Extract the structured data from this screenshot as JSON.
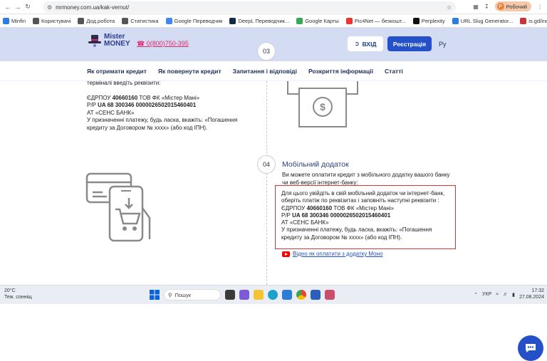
{
  "browser": {
    "url": "mrmoney.com.ua/kak-vernut/",
    "profile_label": "Робочий",
    "profile_initial": "Р"
  },
  "bookmarks": [
    {
      "label": "Minfin",
      "color": "#2a7de1"
    },
    {
      "label": "Користувачі",
      "color": "#555"
    },
    {
      "label": "Дод.робота",
      "color": "#555"
    },
    {
      "label": "Статистика",
      "color": "#555"
    },
    {
      "label": "Google Переводчик",
      "color": "#4285f4"
    },
    {
      "label": "DeepL Переводчик...",
      "color": "#0f2b46"
    },
    {
      "label": "Google Карты",
      "color": "#34a853"
    },
    {
      "label": "Pic4Net — безкошт...",
      "color": "#e33"
    },
    {
      "label": "Perplexity",
      "color": "#111"
    },
    {
      "label": "URL Slug Generator...",
      "color": "#2a7de1"
    },
    {
      "label": "is.gd/index.php",
      "color": "#c33"
    }
  ],
  "header": {
    "logo_line1": "Mister",
    "logo_line2": "MONEY",
    "phone": "0(800)750-395",
    "step_marker": "03",
    "login_label": "ВХІД",
    "register_label": "Реєстрація",
    "language": "Ру"
  },
  "menu": [
    "Як отримати кредит",
    "Як повернути кредит",
    "Запитання і відповіді",
    "Розкриття інформації",
    "Статті"
  ],
  "left_block": {
    "line1": "терміналі введіть реквізити:",
    "line2_prefix": "ЄДРПОУ ",
    "line2_bold": "40660160",
    "line2_suffix": " ТОВ ФК «Містер Мані»",
    "line3_prefix": "Р/Р ",
    "line3_bold": "UA 68 300346 0000026502015460401",
    "line4": "АТ «СЕНС БАНК»",
    "line5": "У призначенні платежу, будь ласка, вкажіть: «Погашення",
    "line6": "кредиту за Договором № хххх» (або код ІПН)."
  },
  "section04": {
    "number": "04",
    "title": "Мобільний додаток",
    "intro1": "Ви можете оплатити кредит з мобільного додатку вашого банку",
    "intro2": "чи веб-версії інтернет-банку:",
    "box_line1": "Для цього увійдіть в свій мобільний додаток чи інтернет-банк,",
    "box_line2": "оберіть платіж по реквізитах і заповніть наступні реквізити :",
    "box_line3_prefix": "ЄДРПОУ ",
    "box_line3_bold": "40660160",
    "box_line3_suffix": " ТОВ ФК «Містер Мані»",
    "box_line4_prefix": "Р/Р ",
    "box_line4_bold": "UA 68 300346 0000026502015460401",
    "box_line5": "АТ «СЕНС БАНК»",
    "box_line6": "У призначенні платежу, будь ласка, вкажіть: «Погашення",
    "box_line7": "кредиту за Договором № хххх» (або код ІПН).",
    "video_link": "Відео як оплатити з додатку Моно"
  },
  "taskbar": {
    "temperature": "20°C",
    "weather": "Теж. сонніщ",
    "search_placeholder": "Пошук",
    "language": "УКР",
    "time": "17:32",
    "date": "27.08.2024"
  },
  "colors": {
    "accent": "#2451c8",
    "header_bg": "#d4dcf4",
    "phone": "#e0246b",
    "highlight_border": "#dd3333"
  }
}
